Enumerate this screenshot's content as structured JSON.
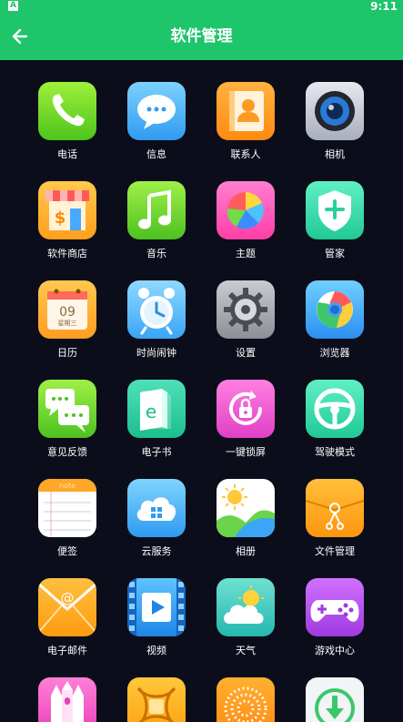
{
  "status_bar": {
    "indicator": "A",
    "time": "9:11"
  },
  "app_bar": {
    "title": "软件管理",
    "back_icon": "arrow-left-icon"
  },
  "apps": [
    {
      "label": "电话",
      "icon": "phone-icon"
    },
    {
      "label": "信息",
      "icon": "message-icon"
    },
    {
      "label": "联系人",
      "icon": "contacts-icon"
    },
    {
      "label": "相机",
      "icon": "camera-icon"
    },
    {
      "label": "软件商店",
      "icon": "store-icon"
    },
    {
      "label": "音乐",
      "icon": "music-icon"
    },
    {
      "label": "主题",
      "icon": "theme-icon"
    },
    {
      "label": "管家",
      "icon": "shield-icon"
    },
    {
      "label": "日历",
      "icon": "calendar-icon",
      "date_day": "09",
      "date_week": "星期三"
    },
    {
      "label": "时尚闹钟",
      "icon": "alarm-clock-icon"
    },
    {
      "label": "设置",
      "icon": "gear-icon"
    },
    {
      "label": "浏览器",
      "icon": "browser-icon"
    },
    {
      "label": "意见反馈",
      "icon": "feedback-icon"
    },
    {
      "label": "电子书",
      "icon": "ebook-icon"
    },
    {
      "label": "一键锁屏",
      "icon": "lock-screen-icon"
    },
    {
      "label": "驾驶模式",
      "icon": "steering-wheel-icon"
    },
    {
      "label": "便签",
      "icon": "note-icon",
      "note_header": "note"
    },
    {
      "label": "云服务",
      "icon": "cloud-service-icon"
    },
    {
      "label": "相册",
      "icon": "gallery-icon"
    },
    {
      "label": "文件管理",
      "icon": "file-manager-icon"
    },
    {
      "label": "电子邮件",
      "icon": "email-icon"
    },
    {
      "label": "视频",
      "icon": "video-icon"
    },
    {
      "label": "天气",
      "icon": "weather-icon"
    },
    {
      "label": "游戏中心",
      "icon": "gamepad-icon"
    },
    {
      "label": "",
      "icon": "castle-icon"
    },
    {
      "label": "",
      "icon": "chip-icon"
    },
    {
      "label": "",
      "icon": "dotted-circle-icon"
    },
    {
      "label": "",
      "icon": "download-icon"
    }
  ],
  "colors": {
    "app_bar": "#1fc56b",
    "background": "#0b0d1a",
    "label_text": "#ffffff"
  }
}
